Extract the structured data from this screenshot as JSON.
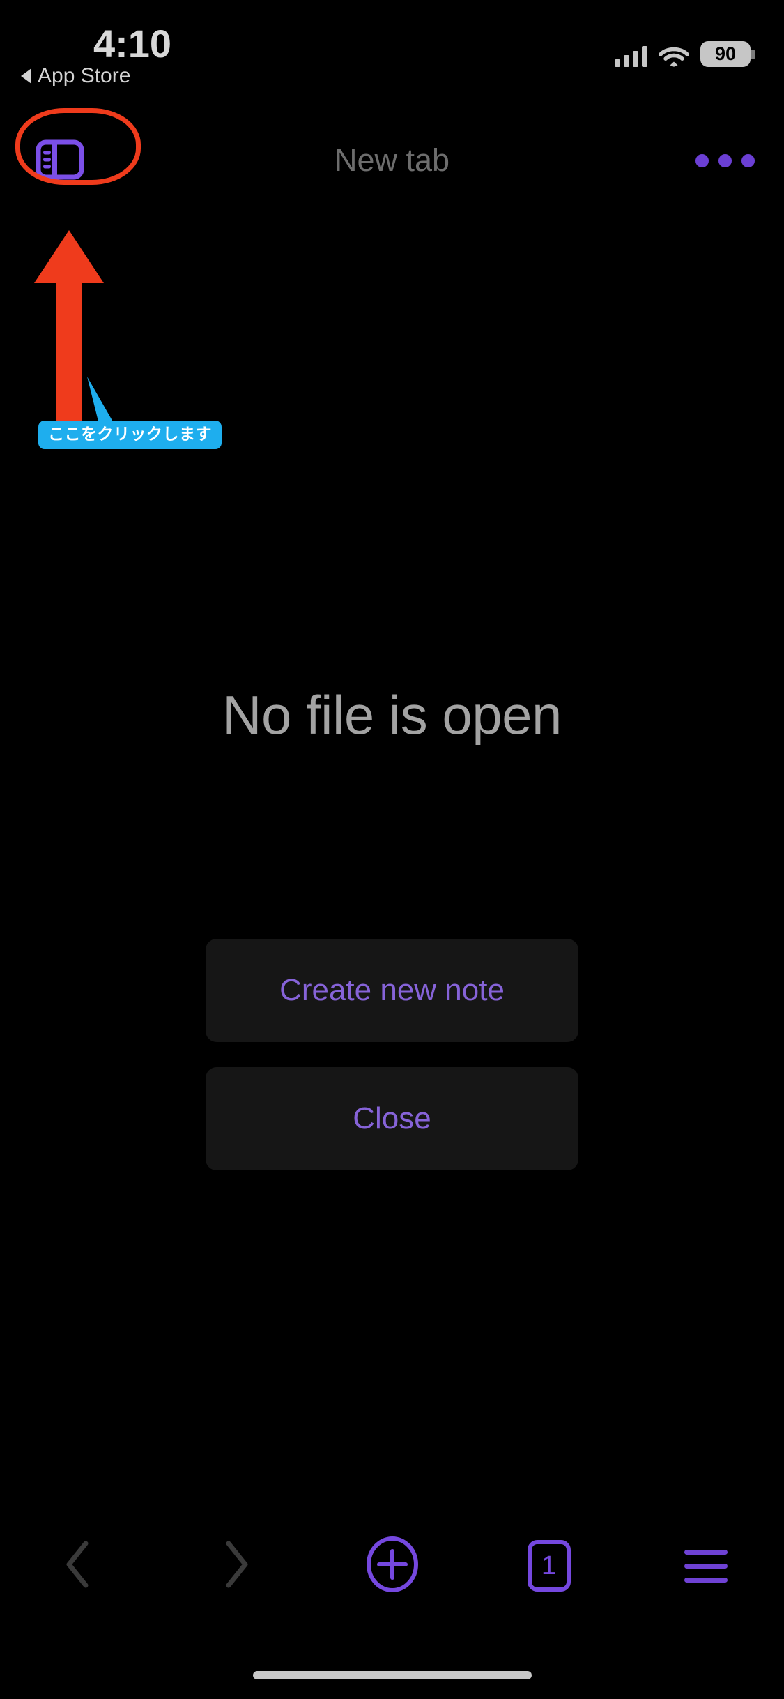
{
  "status_bar": {
    "time": "4:10",
    "battery_percent": "90",
    "signal_icon": "cellular-signal-icon",
    "wifi_icon": "wifi-icon",
    "battery_icon": "battery-icon"
  },
  "back_to_app": {
    "label": "App Store",
    "icon": "back-triangle-icon"
  },
  "toolbar": {
    "sidebar_icon": "sidebar-toggle-icon",
    "tab_title": "New tab",
    "more_icon": "more-horizontal-icon"
  },
  "annotation": {
    "tooltip_text": "ここをクリックします",
    "highlight_color": "#ef3b1c",
    "arrow_color": "#ef3b1c",
    "tooltip_bg": "#1eaeee",
    "tooltip_text_color": "#ffffff",
    "target": "sidebar-toggle-icon"
  },
  "main": {
    "empty_state_title": "No file is open",
    "create_button_label": "Create new note",
    "close_button_label": "Close",
    "button_text_color": "#8663d8",
    "button_bg": "#161616"
  },
  "bottom_bar": {
    "back_icon": "chevron-left-icon",
    "forward_icon": "chevron-right-icon",
    "new_tab_icon": "plus-circle-icon",
    "tab_count": "1",
    "menu_icon": "hamburger-menu-icon",
    "accent_color": "#7548df",
    "disabled_color": "#3a3a3a"
  }
}
